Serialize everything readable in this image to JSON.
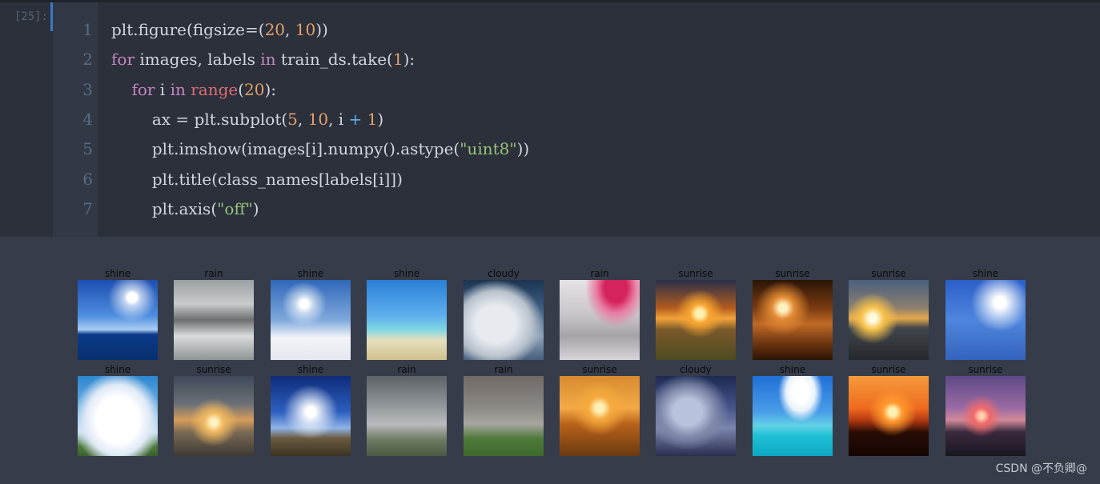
{
  "cell": {
    "prompt": "[25]:"
  },
  "code": {
    "line_numbers": [
      "1",
      "2",
      "3",
      "4",
      "5",
      "6",
      "7"
    ],
    "lines": [
      [
        {
          "t": "plt.figure(figsize=(",
          "c": "plain"
        },
        {
          "t": "20",
          "c": "num"
        },
        {
          "t": ", ",
          "c": "plain"
        },
        {
          "t": "10",
          "c": "num"
        },
        {
          "t": "))",
          "c": "plain"
        }
      ],
      [
        {
          "t": "for",
          "c": "kw"
        },
        {
          "t": " images, labels ",
          "c": "plain"
        },
        {
          "t": "in",
          "c": "kw"
        },
        {
          "t": " train_ds.take(",
          "c": "plain"
        },
        {
          "t": "1",
          "c": "num"
        },
        {
          "t": "):",
          "c": "plain"
        }
      ],
      [
        {
          "t": "    ",
          "c": "plain"
        },
        {
          "t": "for",
          "c": "kw"
        },
        {
          "t": " i ",
          "c": "plain"
        },
        {
          "t": "in",
          "c": "kw"
        },
        {
          "t": " ",
          "c": "plain"
        },
        {
          "t": "range",
          "c": "fn"
        },
        {
          "t": "(",
          "c": "plain"
        },
        {
          "t": "20",
          "c": "num"
        },
        {
          "t": "):",
          "c": "plain"
        }
      ],
      [
        {
          "t": "        ax = plt.subplot(",
          "c": "plain"
        },
        {
          "t": "5",
          "c": "num"
        },
        {
          "t": ", ",
          "c": "plain"
        },
        {
          "t": "10",
          "c": "num"
        },
        {
          "t": ", i ",
          "c": "plain"
        },
        {
          "t": "+",
          "c": "op"
        },
        {
          "t": " ",
          "c": "plain"
        },
        {
          "t": "1",
          "c": "num"
        },
        {
          "t": ")",
          "c": "plain"
        }
      ],
      [
        {
          "t": "        plt.imshow(images[i].numpy().astype(",
          "c": "plain"
        },
        {
          "t": "\"uint8\"",
          "c": "str"
        },
        {
          "t": "))",
          "c": "plain"
        }
      ],
      [
        {
          "t": "        plt.title(class_names[labels[i]])",
          "c": "plain"
        }
      ],
      [
        {
          "t": "        plt.axis(",
          "c": "plain"
        },
        {
          "t": "\"off\"",
          "c": "str"
        },
        {
          "t": ")",
          "c": "plain"
        }
      ]
    ]
  },
  "output": {
    "images": [
      {
        "label": "shine",
        "scene": "sun-sea"
      },
      {
        "label": "rain",
        "scene": "flood"
      },
      {
        "label": "shine",
        "scene": "snow-trees"
      },
      {
        "label": "shine",
        "scene": "beach-palm"
      },
      {
        "label": "cloudy",
        "scene": "cumulus"
      },
      {
        "label": "rain",
        "scene": "pink-rain"
      },
      {
        "label": "sunrise",
        "scene": "orange-field"
      },
      {
        "label": "sunrise",
        "scene": "brown-sunset"
      },
      {
        "label": "sunrise",
        "scene": "gold-shore"
      },
      {
        "label": "shine",
        "scene": "blue-sun"
      },
      {
        "label": "shine",
        "scene": "blue-clouds"
      },
      {
        "label": "sunrise",
        "scene": "grey-sunset"
      },
      {
        "label": "shine",
        "scene": "sun-field"
      },
      {
        "label": "rain",
        "scene": "grey-rain"
      },
      {
        "label": "rain",
        "scene": "green-rain"
      },
      {
        "label": "sunrise",
        "scene": "amber-lake"
      },
      {
        "label": "cloudy",
        "scene": "dusk-clouds"
      },
      {
        "label": "shine",
        "scene": "turquoise-sea"
      },
      {
        "label": "sunrise",
        "scene": "red-sunset"
      },
      {
        "label": "sunrise",
        "scene": "purple-lake"
      }
    ]
  },
  "watermark": "CSDN @不负卿@"
}
